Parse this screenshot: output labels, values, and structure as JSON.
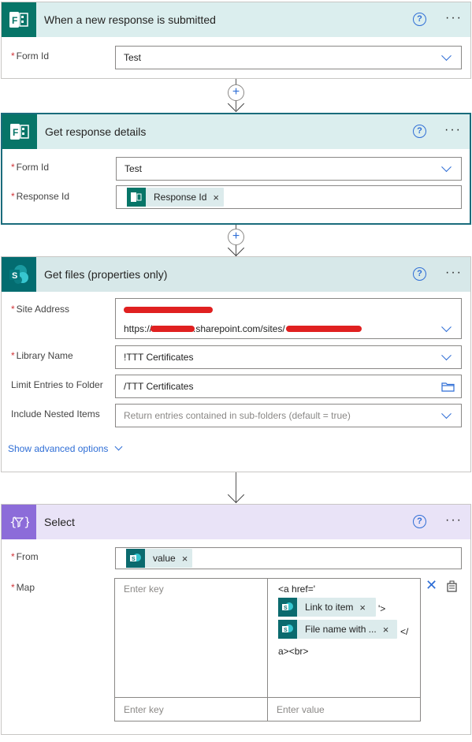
{
  "cards": {
    "trigger": {
      "title": "When a new response is submitted",
      "form_id_label": "Form Id",
      "form_id_value": "Test"
    },
    "get_response": {
      "title": "Get response details",
      "form_id_label": "Form Id",
      "form_id_value": "Test",
      "response_id_label": "Response Id",
      "response_id_token": "Response Id"
    },
    "get_files": {
      "title": "Get files (properties only)",
      "site_address_label": "Site Address",
      "site_address_url_prefix": "https://",
      "site_address_url_mid": ".sharepoint.com/sites/",
      "library_label": "Library Name",
      "library_value": "!TTT Certificates",
      "limit_label": "Limit Entries to Folder",
      "limit_value": "/TTT Certificates",
      "nested_label": "Include Nested Items",
      "nested_placeholder": "Return entries contained in sub-folders (default = true)",
      "advanced_link": "Show advanced options"
    },
    "select": {
      "title": "Select",
      "from_label": "From",
      "from_token": "value",
      "map_label": "Map",
      "enter_key_placeholder": "Enter key",
      "enter_value_placeholder": "Enter value",
      "map_value_line1": "<a href='",
      "map_token_link": "Link to item",
      "map_after_link": "'>",
      "map_token_file": "File name with ...",
      "map_after_file": "</",
      "map_value_line_end": "a><br>"
    }
  },
  "required_marker": "*",
  "help_symbol": "?",
  "more_symbol": "···",
  "token_remove_symbol": "×",
  "colors": {
    "forms_brand": "#077568",
    "sharepoint_brand": "#036c70",
    "select_purple": "#8c6cd9",
    "link_blue": "#2f6ed6",
    "required_red": "#d13438"
  }
}
